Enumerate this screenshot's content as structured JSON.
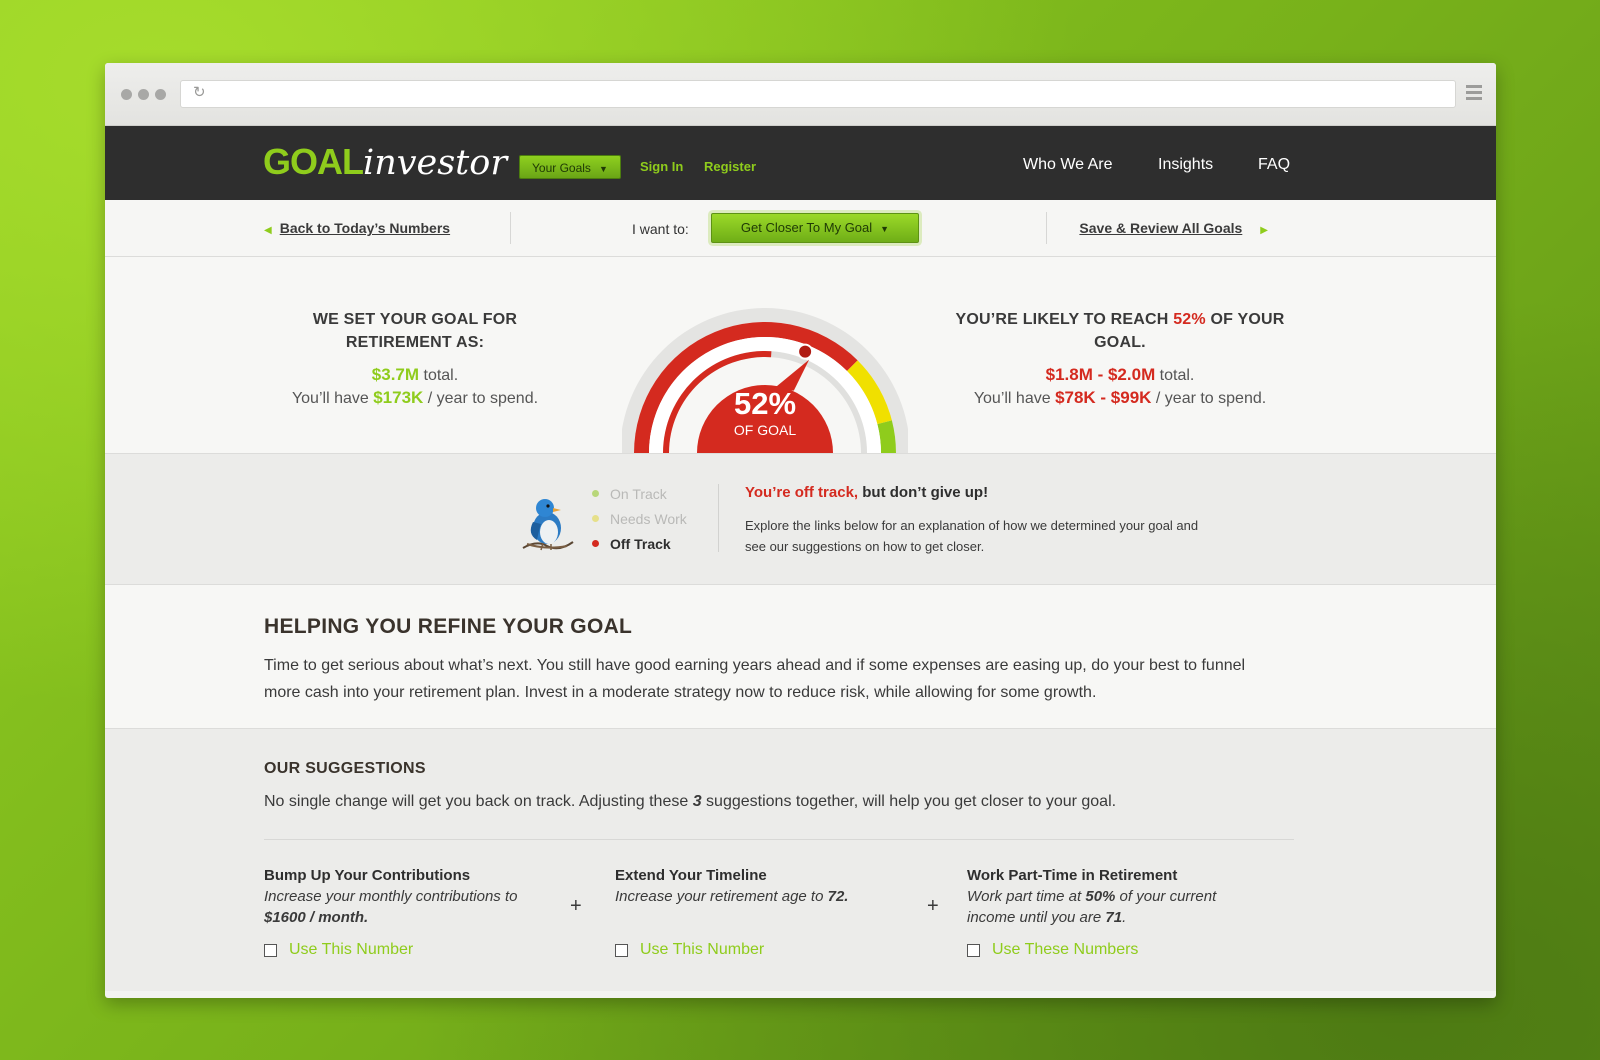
{
  "nav": {
    "logo_goal": "GOAL",
    "logo_investor": "investor",
    "your_goals": "Your Goals",
    "sign_in": "Sign In",
    "register": "Register",
    "who_we_are": "Who We Are",
    "insights": "Insights",
    "faq": "FAQ"
  },
  "action_bar": {
    "back": "Back to Today’s Numbers",
    "i_want_to": "I want to:",
    "goal_select": "Get Closer To My Goal",
    "save": "Save & Review All Goals"
  },
  "goal": {
    "left_head": "WE SET YOUR GOAL FOR RETIREMENT AS:",
    "left_total_value": "$3.7M",
    "left_total_suffix": " total.",
    "left_spend_prefix": "You’ll have ",
    "left_spend_value": "$173K",
    "left_spend_suffix": " / year to spend.",
    "right_head_prefix": "YOU’RE LIKELY TO REACH ",
    "right_head_pct": "52%",
    "right_head_suffix": " OF YOUR GOAL.",
    "right_total_value": "$1.8M - $2.0M",
    "right_total_suffix": " total.",
    "right_spend_prefix": "You’ll have ",
    "right_spend_value": "$78K - $99K",
    "right_spend_suffix": " / year to spend.",
    "gauge_pct_label": "52%",
    "gauge_sub_label": "OF GOAL",
    "gauge_fraction": 0.52
  },
  "status": {
    "legend": [
      {
        "label": "On Track",
        "color": "#b8d77a",
        "active": false
      },
      {
        "label": "Needs Work",
        "color": "#e6e08a",
        "active": false
      },
      {
        "label": "Off Track",
        "color": "#d42a1f",
        "active": true
      }
    ],
    "head_red": "You’re off track,",
    "head_rest": " but don’t give up!",
    "body": "Explore the links below for an explanation of how we determined your goal and see our suggestions on how to get closer."
  },
  "refine": {
    "title": "HELPING YOU REFINE YOUR GOAL",
    "body": "Time to get serious about what’s next. You still have good earning years ahead and if some expenses are easing up, do your best to funnel more cash into your retirement plan. Invest in a moderate strategy now to reduce risk, while allowing for some growth."
  },
  "suggestions": {
    "title": "OUR SUGGESTIONS",
    "intro_prefix": "No single change will get you back on track. Adjusting these ",
    "intro_count": "3",
    "intro_suffix": " suggestions together, will help you get closer to your goal.",
    "plus": "+",
    "items": [
      {
        "title": "Bump Up Your Contributions",
        "desc_prefix": "Increase your monthly contributions to ",
        "desc_bold": "$1600 / month.",
        "desc_suffix": "",
        "action": "Use This Number"
      },
      {
        "title": "Extend Your Timeline",
        "desc_prefix": "Increase your retirement age to ",
        "desc_bold": "72.",
        "desc_suffix": "",
        "action": "Use This Number"
      },
      {
        "title": "Work Part-Time in Retirement",
        "desc_prefix": "Work part time at ",
        "desc_bold": "50%",
        "desc_suffix": " of your current income until you are ",
        "desc_bold2": "71",
        "desc_suffix2": ".",
        "action": "Use These Numbers"
      }
    ]
  },
  "colors": {
    "brand_green": "#8fcc1c",
    "alert_red": "#d42a1f",
    "nav_dark": "#2e2e2e",
    "gauge_yellow": "#f0e000"
  }
}
